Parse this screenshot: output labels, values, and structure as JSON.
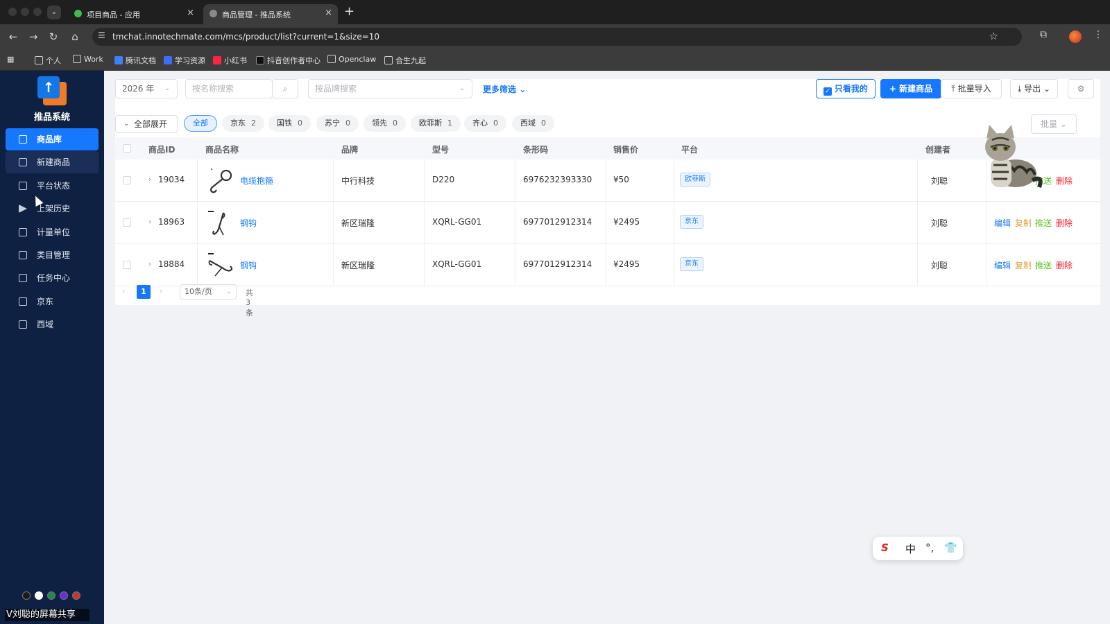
{
  "browser": {
    "tabs": [
      {
        "title": "项目商品 - 应用",
        "active": false,
        "favicon_color": "#3fb950"
      },
      {
        "title": "商品管理 - 推品系统",
        "active": true,
        "favicon_color": "#8a8a8a"
      }
    ],
    "new_tab_label": "+",
    "close_label": "×",
    "url": "tmchat.innotechmate.com/mcs/product/list?current=1&size=10",
    "bookmarks": [
      {
        "label": "个人",
        "type": "folder"
      },
      {
        "label": "Work",
        "type": "folder"
      },
      {
        "label": "腾讯文档",
        "type": "site",
        "color": "#3b82f6"
      },
      {
        "label": "学习资源",
        "type": "site",
        "color": "#3b6ef6"
      },
      {
        "label": "小红书",
        "type": "site",
        "color": "#ff2442"
      },
      {
        "label": "抖音创作者中心",
        "type": "site",
        "color": "#111111"
      },
      {
        "label": "Openclaw",
        "type": "folder"
      },
      {
        "label": "合生九起",
        "type": "folder"
      }
    ]
  },
  "sidebar": {
    "title": "推品系统",
    "items": [
      {
        "label": "商品库",
        "icon": "library-icon",
        "state": "active"
      },
      {
        "label": "新建商品",
        "icon": "new-doc-icon",
        "state": "sub"
      },
      {
        "label": "平台状态",
        "icon": "monitor-icon",
        "state": "normal"
      },
      {
        "label": "上架历史",
        "icon": "send-icon",
        "state": "normal"
      },
      {
        "label": "计量单位",
        "icon": "unit-icon",
        "state": "normal"
      },
      {
        "label": "类目管理",
        "icon": "category-icon",
        "state": "normal"
      },
      {
        "label": "任务中心",
        "icon": "clipboard-icon",
        "state": "normal"
      },
      {
        "label": "京东",
        "icon": "doc-icon",
        "state": "normal"
      },
      {
        "label": "西域",
        "icon": "doc-icon",
        "state": "normal"
      }
    ],
    "theme_colors": [
      "#1a1a1a",
      "#ffffff",
      "#1f8a4c",
      "#6c2bd9",
      "#c0392b"
    ],
    "share_label": "V刘聪的屏幕共享"
  },
  "filters": {
    "year": "2026 年",
    "name_placeholder": "按名称搜索",
    "brand_placeholder": "按品牌搜索",
    "more_filters": "更多筛选",
    "only_mine": "只看我的",
    "new_product": "新建商品",
    "batch_import": "批量导入",
    "export": "导出",
    "batch": "批量",
    "expand_all": "全部展开"
  },
  "platform_chips": [
    {
      "label": "全部",
      "count": "",
      "active": true
    },
    {
      "label": "京东",
      "count": "2",
      "active": false
    },
    {
      "label": "国铁",
      "count": "0",
      "active": false
    },
    {
      "label": "苏宁",
      "count": "0",
      "active": false
    },
    {
      "label": "领先",
      "count": "0",
      "active": false
    },
    {
      "label": "欧菲斯",
      "count": "1",
      "active": false
    },
    {
      "label": "齐心",
      "count": "0",
      "active": false
    },
    {
      "label": "西域",
      "count": "0",
      "active": false
    }
  ],
  "table": {
    "columns": [
      "商品ID",
      "商品名称",
      "品牌",
      "型号",
      "条形码",
      "销售价",
      "平台",
      "创建者"
    ],
    "rows": [
      {
        "id": "19034",
        "name": "电缆抱箍",
        "brand": "中行科技",
        "model": "D220",
        "barcode": "6976232393330",
        "price": "¥50",
        "platform": "欧菲斯",
        "creator": "刘聪"
      },
      {
        "id": "18963",
        "name": "钢钩",
        "brand": "新区瑞隆",
        "model": "XQRL-GG01",
        "barcode": "6977012912314",
        "price": "¥2495",
        "platform": "京东",
        "creator": "刘聪"
      },
      {
        "id": "18884",
        "name": "钢钩",
        "brand": "新区瑞隆",
        "model": "XQRL-GG01",
        "barcode": "6977012912314",
        "price": "¥2495",
        "platform": "京东",
        "creator": "刘聪"
      }
    ],
    "actions": {
      "edit": "编辑",
      "copy": "复制",
      "push": "推送",
      "delete": "删除"
    }
  },
  "pagination": {
    "current_page": "1",
    "page_size": "10条/页",
    "total": "共 3 条"
  },
  "ime_toolbar": {
    "logo": "S",
    "mode": "中",
    "punct": "°,",
    "skin_icon": "shirt-icon"
  }
}
